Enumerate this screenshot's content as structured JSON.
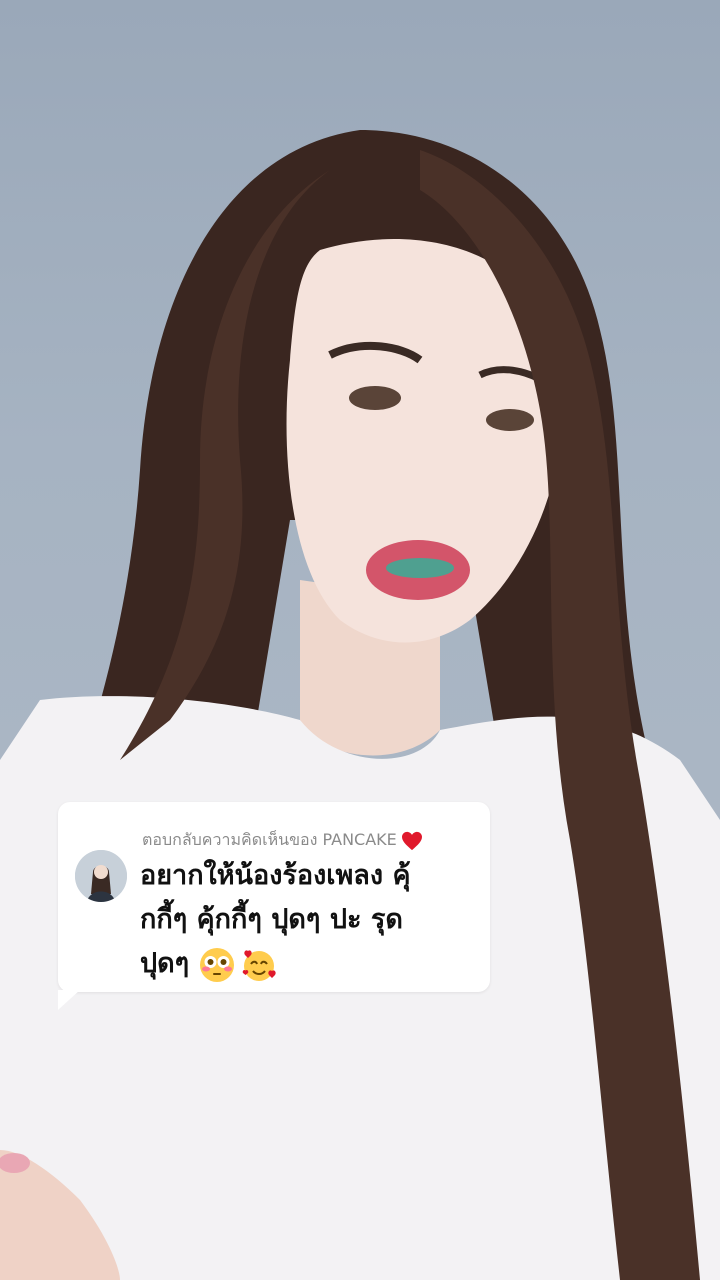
{
  "reply": {
    "header": "ตอบกลับความคิดเห็นของ PANCAKE",
    "comment": "อยากให้น้องร้องเพลง คุ้\nกกี้ๆ คุ้กกี้ๆ ปุดๆ ปะ รุด\nปุดๆ",
    "emojis": [
      "flushed-face-icon",
      "smiling-face-with-hearts-icon"
    ]
  },
  "colors": {
    "card_background": "#ffffff",
    "header_text": "#8a8a8a",
    "comment_text": "#111111",
    "heart": "#e0192c"
  }
}
